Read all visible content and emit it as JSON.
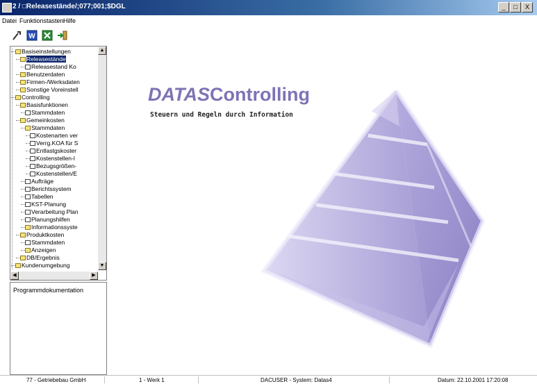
{
  "window": {
    "title": "2 / □Releasestände/;077;001;$DGL",
    "buttons": [
      "_",
      "□",
      "X"
    ]
  },
  "menu": [
    "Datei",
    "Funktionstasten",
    "Hilfe"
  ],
  "toolbar": [
    "wrench-icon",
    "word-icon",
    "excel-icon",
    "exit-icon"
  ],
  "tree": [
    {
      "label": "Basiseinstellungen",
      "level": 0,
      "type": "folder"
    },
    {
      "label": "Releasestände",
      "level": 1,
      "type": "folder",
      "selected": true
    },
    {
      "label": "Releasestand Ko",
      "level": 2,
      "type": "doc"
    },
    {
      "label": "Benutzerdaten",
      "level": 1,
      "type": "folder"
    },
    {
      "label": "Firmen-/Werksdaten",
      "level": 1,
      "type": "folder"
    },
    {
      "label": "Sonstige Voreinstell",
      "level": 1,
      "type": "folder"
    },
    {
      "label": "Controlling",
      "level": 0,
      "type": "folder"
    },
    {
      "label": "Basisfunktionen",
      "level": 1,
      "type": "folder"
    },
    {
      "label": "Stammdaten",
      "level": 2,
      "type": "doc"
    },
    {
      "label": "Gemeinkosten",
      "level": 1,
      "type": "folder"
    },
    {
      "label": "Stammdaten",
      "level": 2,
      "type": "folder"
    },
    {
      "label": "Kostenarten ver",
      "level": 3,
      "type": "doc"
    },
    {
      "label": "Verrg.KOA für S",
      "level": 3,
      "type": "doc"
    },
    {
      "label": "Entlastgskoster",
      "level": 3,
      "type": "doc"
    },
    {
      "label": "Kostenstellen-l",
      "level": 3,
      "type": "doc"
    },
    {
      "label": "Bezugsgrößen-",
      "level": 3,
      "type": "doc"
    },
    {
      "label": "Kostenstellen/E",
      "level": 3,
      "type": "doc"
    },
    {
      "label": "Aufträge",
      "level": 2,
      "type": "doc"
    },
    {
      "label": "Berichtssystem",
      "level": 2,
      "type": "doc"
    },
    {
      "label": "Tabellen",
      "level": 2,
      "type": "doc"
    },
    {
      "label": "KST-Planung",
      "level": 2,
      "type": "doc"
    },
    {
      "label": "Verarbeitung Plan",
      "level": 2,
      "type": "doc"
    },
    {
      "label": "Planungshilfen",
      "level": 2,
      "type": "doc"
    },
    {
      "label": "Informationssyste",
      "level": 2,
      "type": "folder"
    },
    {
      "label": "Produktkosten",
      "level": 1,
      "type": "folder"
    },
    {
      "label": "Stammdaten",
      "level": 2,
      "type": "doc"
    },
    {
      "label": "Anzeigen",
      "level": 2,
      "type": "folder"
    },
    {
      "label": "DB/Ergebnis",
      "level": 1,
      "type": "folder"
    },
    {
      "label": "Kundenumgebung",
      "level": 0,
      "type": "folder"
    }
  ],
  "doc_panel": {
    "label": "Programmdokumentation"
  },
  "brand": {
    "part1": "DATAS",
    "part2": "Controlling",
    "slogan": "Steuern und Regeln durch Information",
    "color": "#7d74b5"
  },
  "status": {
    "company": "77 - Getriebebau GmbH",
    "plant": "1 - Werk 1",
    "user": "DACUSER - System: Datas4",
    "date": "Datum: 22.10.2001 17:20:08"
  }
}
